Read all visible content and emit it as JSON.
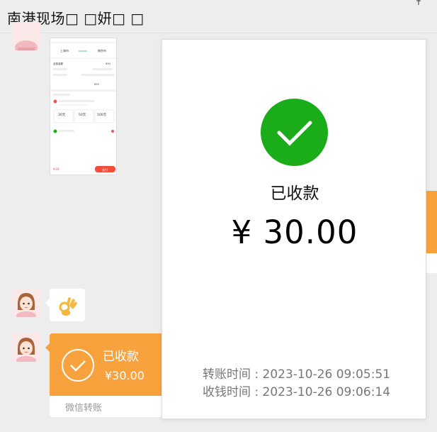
{
  "window": {
    "title": "南港现场□ □妍□ □"
  },
  "chat": {
    "transfer_bubble": {
      "status": "已收款",
      "amount": "¥30.00",
      "footer": "微信转账"
    },
    "screenshot_thumbnail": {
      "from_city": "上海市",
      "to_city": "南京市",
      "label_1": "全部金额",
      "amount_1": "¥30",
      "total": "¥30",
      "option_1": "30元",
      "option_2": "50元",
      "option_3": "100元",
      "button": "支付",
      "bottom_amount": "¥30"
    }
  },
  "receipt_popup": {
    "status": "已收款",
    "amount": "¥ 30.00",
    "transfer_time_label": "转账时间 : 2023-10-26 09:05:51",
    "received_time_label": "收钱时间 : 2023-10-26 09:06:14"
  },
  "colors": {
    "accent_orange": "#f7a23d",
    "success_green": "#1aad19",
    "background": "#ededed"
  }
}
